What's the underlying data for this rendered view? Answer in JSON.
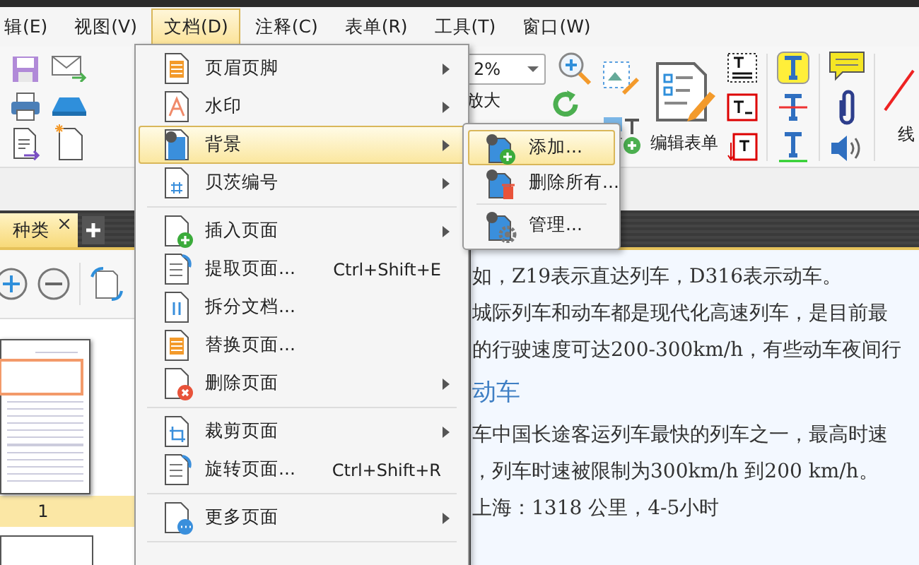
{
  "menu_bar": [
    {
      "label": "辑(E)",
      "selected": false
    },
    {
      "label": "视图(V)",
      "selected": false
    },
    {
      "label": "文档(D)",
      "selected": true
    },
    {
      "label": "注释(C)",
      "selected": false
    },
    {
      "label": "表单(R)",
      "selected": false
    },
    {
      "label": "工具(T)",
      "selected": false
    },
    {
      "label": "窗口(W)",
      "selected": false
    }
  ],
  "toolbar": {
    "zoom_value": "2%",
    "zoom_in_label": "放大",
    "edit_form_label": "编辑表单",
    "line_label": "线"
  },
  "tabs": [
    {
      "label": "种类",
      "selected": true
    }
  ],
  "thumbnail_page": {
    "label": "1",
    "selected": true
  },
  "document": {
    "lines": [
      {
        "kind": "text",
        "text": "如，Z19表示直达列车，D316表示动车。"
      },
      {
        "kind": "text",
        "text": "城际列车和动车都是现代化高速列车，是目前最"
      },
      {
        "kind": "text",
        "text": "的行驶速度可达200-300km/h，有些动车夜间行"
      },
      {
        "kind": "heading",
        "text": "动车"
      },
      {
        "kind": "text",
        "text": "车中国长途客运列车最快的列车之一，最高时速"
      },
      {
        "kind": "text",
        "text": "，列车时速被限制为300km/h 到200 km/h。"
      },
      {
        "kind": "text",
        "text": "上海：1318 公里，4-5小时"
      }
    ]
  },
  "document_menu": [
    {
      "kind": "item",
      "label": "页眉页脚",
      "submenu": true,
      "selected": false
    },
    {
      "kind": "item",
      "label": "水印",
      "submenu": true,
      "selected": false
    },
    {
      "kind": "item",
      "label": "背景",
      "submenu": true,
      "selected": true
    },
    {
      "kind": "item",
      "label": "贝茨编号",
      "submenu": true,
      "selected": false
    },
    {
      "kind": "separator"
    },
    {
      "kind": "item",
      "label": "插入页面",
      "submenu": true,
      "selected": false
    },
    {
      "kind": "item",
      "label": "提取页面...",
      "shortcut": "Ctrl+Shift+E",
      "submenu": false,
      "selected": false
    },
    {
      "kind": "item",
      "label": "拆分文档...",
      "submenu": false,
      "selected": false
    },
    {
      "kind": "item",
      "label": "替换页面...",
      "submenu": false,
      "selected": false
    },
    {
      "kind": "item",
      "label": "删除页面",
      "submenu": true,
      "selected": false
    },
    {
      "kind": "separator"
    },
    {
      "kind": "item",
      "label": "裁剪页面",
      "submenu": true,
      "selected": false
    },
    {
      "kind": "item",
      "label": "旋转页面...",
      "shortcut": "Ctrl+Shift+R",
      "submenu": false,
      "selected": false
    },
    {
      "kind": "separator"
    },
    {
      "kind": "item",
      "label": "更多页面",
      "submenu": true,
      "selected": false
    },
    {
      "kind": "separator"
    }
  ],
  "background_submenu": [
    {
      "kind": "item",
      "label": "添加...",
      "selected": true
    },
    {
      "kind": "item",
      "label": "删除所有...",
      "selected": false
    },
    {
      "kind": "separator"
    },
    {
      "kind": "item",
      "label": "管理...",
      "selected": false
    }
  ]
}
